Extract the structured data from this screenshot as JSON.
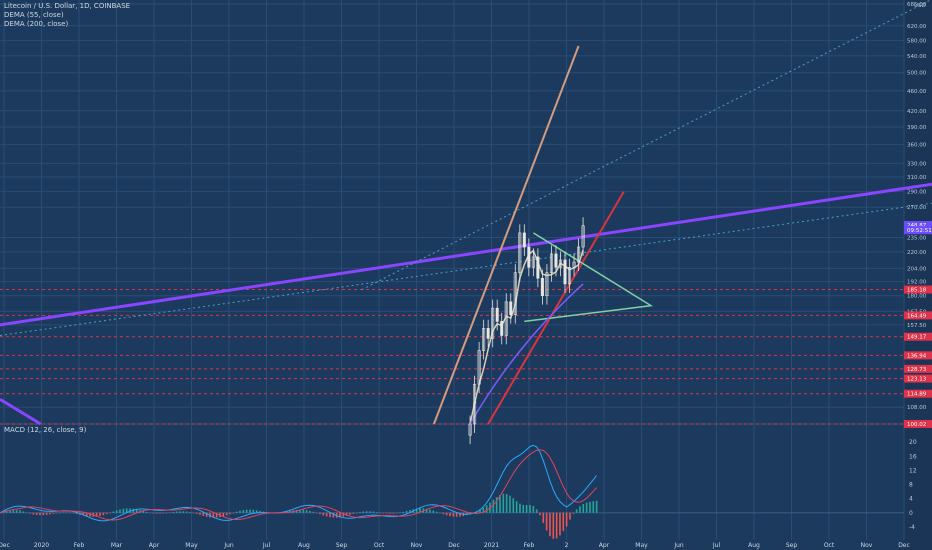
{
  "legend": {
    "title": "Litecoin / U.S. Dollar, 1D, COINBASE",
    "dema55": "DEMA (55, close)",
    "dema200": "DEMA (200, close)"
  },
  "macd": {
    "label": "MACD (12, 26, close, 9)"
  },
  "currency_label": "USD",
  "colors": {
    "background": "#1c3a5e",
    "grid": "#2a4d75",
    "candle": "#e8e6df",
    "dema55": "#d8d0b2",
    "dema200": "#7a5cff",
    "resistance": "#8a45ff",
    "support_dash": "#e0324a",
    "wedge": "#7fd3a0",
    "orange_line": "#d59b7c",
    "red_trend": "#d9343f",
    "macd_line": "#2aa9ff",
    "signal_line": "#e0435f",
    "hist_pos": "#26a69a",
    "hist_neg": "#ef5350"
  },
  "chart_data": [
    {
      "type": "line",
      "title": "Litecoin / U.S. Dollar, 1D, COINBASE",
      "log_scale": true,
      "ylim": [
        100,
        685
      ],
      "price_ticks": [
        685,
        620,
        580,
        540,
        500,
        460,
        420,
        390,
        360,
        330,
        310,
        290,
        270,
        235,
        220,
        204,
        192,
        180,
        167.5,
        157.5,
        108
      ],
      "price_labels": [
        {
          "value": "185.18",
          "price": 185.18,
          "color": "#e0324a"
        },
        {
          "value": "164.49",
          "price": 164.49,
          "color": "#e0324a"
        },
        {
          "value": "149.17",
          "price": 149.17,
          "color": "#e0324a"
        },
        {
          "value": "136.94",
          "price": 136.94,
          "color": "#e0324a"
        },
        {
          "value": "128.73",
          "price": 128.73,
          "color": "#e0324a"
        },
        {
          "value": "123.13",
          "price": 123.13,
          "color": "#e0324a"
        },
        {
          "value": "114.89",
          "price": 114.89,
          "color": "#e0324a"
        },
        {
          "value": "100.02",
          "price": 100.02,
          "color": "#e0324a"
        },
        {
          "value": "248.87",
          "price": 248.87,
          "color": "#6b4cff"
        },
        {
          "value": "09:52:51",
          "price": 243,
          "color": "#6b4cff"
        }
      ],
      "support_levels": [
        185.18,
        164.49,
        149.17,
        136.94,
        128.73,
        123.13,
        114.89,
        100.02
      ],
      "x_ticks": [
        "Dec",
        "2020",
        "Feb",
        "Mar",
        "Apr",
        "May",
        "Jun",
        "Jul",
        "Aug",
        "Sep",
        "Oct",
        "Nov",
        "Dec",
        "2021",
        "Feb",
        "2",
        "Apr",
        "May",
        "Jun",
        "Jul",
        "Aug",
        "Sep",
        "Oct",
        "Nov",
        "Dec"
      ],
      "candles_close": [
        {
          "x": 0.52,
          "close": 100
        },
        {
          "x": 0.525,
          "close": 120
        },
        {
          "x": 0.53,
          "close": 140
        },
        {
          "x": 0.535,
          "close": 155
        },
        {
          "x": 0.54,
          "close": 148
        },
        {
          "x": 0.545,
          "close": 170
        },
        {
          "x": 0.55,
          "close": 160
        },
        {
          "x": 0.555,
          "close": 150
        },
        {
          "x": 0.56,
          "close": 175
        },
        {
          "x": 0.565,
          "close": 165
        },
        {
          "x": 0.57,
          "close": 200
        },
        {
          "x": 0.575,
          "close": 240
        },
        {
          "x": 0.58,
          "close": 225
        },
        {
          "x": 0.585,
          "close": 205
        },
        {
          "x": 0.59,
          "close": 215
        },
        {
          "x": 0.595,
          "close": 195
        },
        {
          "x": 0.6,
          "close": 180
        },
        {
          "x": 0.605,
          "close": 200
        },
        {
          "x": 0.61,
          "close": 218
        },
        {
          "x": 0.615,
          "close": 205
        },
        {
          "x": 0.62,
          "close": 212
        },
        {
          "x": 0.625,
          "close": 190
        },
        {
          "x": 0.63,
          "close": 205
        },
        {
          "x": 0.635,
          "close": 210
        },
        {
          "x": 0.64,
          "close": 225
        },
        {
          "x": 0.645,
          "close": 248
        }
      ]
    },
    {
      "type": "bar",
      "title": "MACD (12, 26, close, 9)",
      "ylim": [
        -6,
        24
      ],
      "y_ticks": [
        20,
        16,
        12,
        8,
        4,
        0,
        -4
      ],
      "histogram_hint": "MACD histogram with MACD and signal lines"
    }
  ]
}
